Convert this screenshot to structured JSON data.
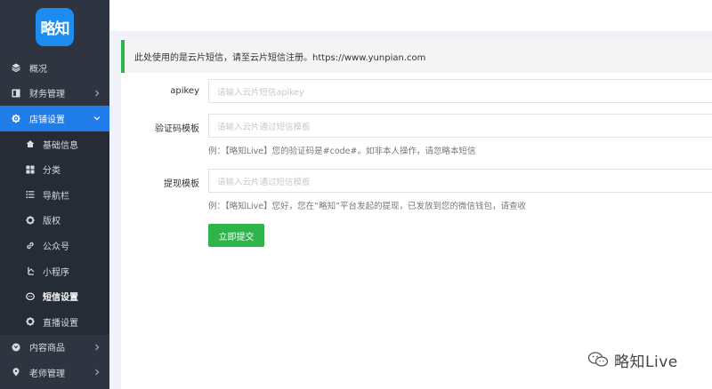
{
  "brand": {
    "logo_text": "略知",
    "accent": "#1f7ce8"
  },
  "sidebar": {
    "items": [
      {
        "label": "概况",
        "icon": "layers-icon"
      },
      {
        "label": "财务管理",
        "icon": "finance-icon"
      },
      {
        "label": "店铺设置",
        "icon": "gear-icon"
      },
      {
        "label": "基础信息",
        "icon": "home-icon"
      },
      {
        "label": "分类",
        "icon": "grid-icon"
      },
      {
        "label": "导航栏",
        "icon": "list-icon"
      },
      {
        "label": "版权",
        "icon": "gear-icon"
      },
      {
        "label": "公众号",
        "icon": "link-icon"
      },
      {
        "label": "小程序",
        "icon": "miniprogram-icon"
      },
      {
        "label": "短信设置",
        "icon": "chat-bubble-icon"
      },
      {
        "label": "直播设置",
        "icon": "gear-icon"
      },
      {
        "label": "内容商品",
        "icon": "gift-icon"
      },
      {
        "label": "老师管理",
        "icon": "location-pin-icon"
      }
    ]
  },
  "notice": {
    "text": "此处使用的是云片短信，请至云片短信注册。https://www.yunpian.com",
    "color": "#2db54b"
  },
  "form": {
    "apikey": {
      "label": "apikey",
      "placeholder": "请输入云片短信apikey"
    },
    "verify": {
      "label": "验证码模板",
      "placeholder": "请输入云片通过短信模板",
      "help": "例：【略知Live】您的验证码是#code#。如非本人操作，请忽略本短信"
    },
    "withdraw": {
      "label": "提现模板",
      "placeholder": "请输入云片通过短信模板",
      "help": "例：【略知Live】您好，您在“略知”平台发起的提现，已发放到您的微信钱包，请查收"
    },
    "submit_label": "立即提交"
  },
  "watermark": {
    "text": "略知Live"
  }
}
